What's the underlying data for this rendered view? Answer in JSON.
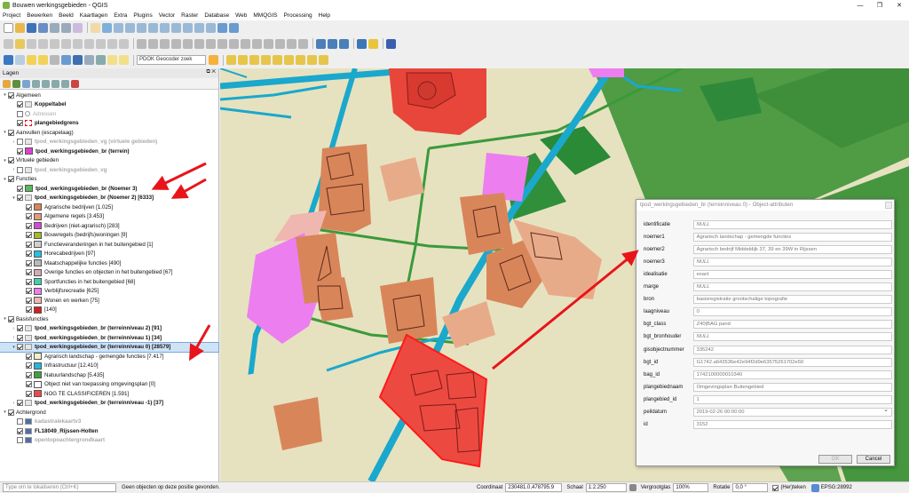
{
  "window": {
    "title": "Bouwen werkingsgebieden - QGIS",
    "controls": [
      "—",
      "❐",
      "✕"
    ]
  },
  "menu": [
    "Project",
    "Bewerken",
    "Beeld",
    "Kaartlagen",
    "Extra",
    "Plugins",
    "Vector",
    "Raster",
    "Database",
    "Web",
    "MMQGIS",
    "Processing",
    "Help"
  ],
  "toolbar": {
    "geocoder_placeholder": "PDOK Geocoder zoek"
  },
  "layers_panel": {
    "title": "Lagen",
    "controls": "⧉ ✕",
    "rows": [
      {
        "label": "Algemeen",
        "lvl": 0,
        "arrow": "▾",
        "cb": true
      },
      {
        "label": "Koppeltabel",
        "lvl": 1,
        "cb": true,
        "bold": true,
        "icon": "table"
      },
      {
        "label": "Adressen",
        "lvl": 1,
        "cb": false,
        "grey": true,
        "icon": "point"
      },
      {
        "label": "plangebiedgrens",
        "lvl": 1,
        "cb": true,
        "bold": true,
        "icon": "border"
      },
      {
        "label": "Aanvullen (escapelaag)",
        "lvl": 0,
        "arrow": "▾",
        "cb": true
      },
      {
        "label": "tpod_werkingsgebieden_vg (virtuele gebieden)",
        "lvl": 1,
        "arrow": "›",
        "cb": false,
        "grey": true,
        "bold": true,
        "icon": "group"
      },
      {
        "label": "tpod_werkingsgebieden_br (terrein)",
        "lvl": 1,
        "cb": true,
        "bold": true,
        "swatch": "#e040d0"
      },
      {
        "label": "Virtuele gebieden",
        "lvl": 0,
        "arrow": "▾",
        "cb": true
      },
      {
        "label": "tpod_werkingsgebieden_vg",
        "lvl": 1,
        "arrow": "›",
        "cb": false,
        "grey": true,
        "bold": true,
        "icon": "group"
      },
      {
        "label": "Functies",
        "lvl": 0,
        "arrow": "▾",
        "cb": true
      },
      {
        "label": "tpod_werkingsgebieden_br (Noemer 3)",
        "lvl": 1,
        "cb": true,
        "bold": true,
        "swatch": "#5cb85c"
      },
      {
        "label": "tpod_werkingsgebieden_br (Noemer 2) [6333]",
        "lvl": 1,
        "arrow": "▾",
        "cb": true,
        "bold": true,
        "icon": "group"
      },
      {
        "label": "Agrarische bedrijven [1.025]",
        "lvl": 2,
        "cb": true,
        "swatch": "#d9855a"
      },
      {
        "label": "Algemene regels [3.453]",
        "lvl": 2,
        "cb": true,
        "swatch": "#e89a76"
      },
      {
        "label": "Bedrijven (niet-agrarisch) [283]",
        "lvl": 2,
        "cb": true,
        "swatch": "#d24bd6"
      },
      {
        "label": "Bouwregels (bedrijfs)woningen [9]",
        "lvl": 2,
        "cb": true,
        "swatch": "#a7b82a"
      },
      {
        "label": "Functieveranderingen in het buitengebied [1]",
        "lvl": 2,
        "cb": true,
        "swatch": "#cfcfcf"
      },
      {
        "label": "Horecabedrijven [97]",
        "lvl": 2,
        "cb": true,
        "swatch": "#1fc2e8"
      },
      {
        "label": "Maatschappelijke functies [490]",
        "lvl": 2,
        "cb": true,
        "swatch": "#b9b9b9"
      },
      {
        "label": "Overige functies en objecten in het buitengebied [67]",
        "lvl": 2,
        "cb": true,
        "swatch": "#d6a9b0"
      },
      {
        "label": "Sportfuncties in het buitengebied [68]",
        "lvl": 2,
        "cb": true,
        "swatch": "#3fd0b0"
      },
      {
        "label": "Verblijfsrecreatie [625]",
        "lvl": 2,
        "cb": true,
        "swatch": "#ec7ef0"
      },
      {
        "label": "Wonen en werken [75]",
        "lvl": 2,
        "cb": true,
        "swatch": "#f0b7b0"
      },
      {
        "label": "[140]",
        "lvl": 2,
        "cb": true,
        "swatch": "#d71f1f"
      },
      {
        "label": "Basisfuncties",
        "lvl": 0,
        "arrow": "▾",
        "cb": true
      },
      {
        "label": "tpod_werkingsgebieden_br (terreinniveau 2) [91]",
        "lvl": 1,
        "arrow": "›",
        "cb": true,
        "bold": true,
        "icon": "group"
      },
      {
        "label": "tpod_werkingsgebieden_br (terreinniveau 1) [34]",
        "lvl": 1,
        "arrow": "›",
        "cb": true,
        "bold": true,
        "icon": "group"
      },
      {
        "label": "tpod_werkingsgebieden_br (terreinniveau 0) [28579]",
        "lvl": 1,
        "arrow": "▾",
        "cb": true,
        "bold": true,
        "icon": "group",
        "selected": true
      },
      {
        "label": "Agrarisch landschap - gemengde functies [7.417]",
        "lvl": 2,
        "cb": true,
        "swatch": "#f3efc2"
      },
      {
        "label": "Infrastructuur [12.410]",
        "lvl": 2,
        "cb": true,
        "swatch": "#22b8d8"
      },
      {
        "label": "Natuurlandschap [5.435]",
        "lvl": 2,
        "cb": true,
        "swatch": "#41a13b"
      },
      {
        "label": "Object niet van toepassing omgevingsplan [0]",
        "lvl": 2,
        "cb": true,
        "swatch": "#ffffff"
      },
      {
        "label": "NOG TE CLASSIFICEREN [1.591]",
        "lvl": 2,
        "cb": true,
        "swatch": "#ef4a4a"
      },
      {
        "label": "tpod_werkingsgebieden_br (terreinniveau -1) [37]",
        "lvl": 1,
        "arrow": "›",
        "cb": true,
        "bold": true,
        "icon": "group"
      },
      {
        "label": "Achtergrond",
        "lvl": 0,
        "arrow": "▾",
        "cb": true
      },
      {
        "label": "kadastralekaartv3",
        "lvl": 1,
        "cb": false,
        "grey": true,
        "bold": true,
        "icon": "raster"
      },
      {
        "label": "FL18049_Rijssen-Holten",
        "lvl": 1,
        "cb": true,
        "bold": true,
        "icon": "raster"
      },
      {
        "label": "opentopoachtergrondkaart",
        "lvl": 1,
        "cb": false,
        "grey": true,
        "bold": true,
        "icon": "raster"
      }
    ]
  },
  "dialog": {
    "title": "tpod_werkingsgebieden_br (terreinniveau 0) - Object-attributen",
    "fields": [
      {
        "label": "identificatie",
        "value": "NULL"
      },
      {
        "label": "noemer1",
        "value": "Agrarisch landschap - gemengde functies"
      },
      {
        "label": "noemer2",
        "value": "Agrarisch bedrijf Middeldijk 37, 39 en 39W in Rijssen"
      },
      {
        "label": "noemer3",
        "value": "NULL"
      },
      {
        "label": "idealisatie",
        "value": "exact"
      },
      {
        "label": "marge",
        "value": "NULL"
      },
      {
        "label": "bron",
        "value": "basisregistratie grootschalige topografie"
      },
      {
        "label": "laagniveau",
        "value": "0"
      },
      {
        "label": "bgt_class",
        "value": "Z40|BAG pand"
      },
      {
        "label": "bgt_bronhouder",
        "value": "NULL"
      },
      {
        "label": "gisobjectnummer",
        "value": "335242"
      },
      {
        "label": "bgt_id",
        "value": "G1742.a643536e42e94f2d9e63575261702e50"
      },
      {
        "label": "bag_id",
        "value": "1742100000010340"
      },
      {
        "label": "plangebiednaam",
        "value": "Omgevingsplan Buitengebied"
      },
      {
        "label": "plangebied_id",
        "value": "1"
      },
      {
        "label": "peildatum",
        "value": "2019-02-26 00:00:00",
        "combo": true
      },
      {
        "label": "id",
        "value": "3152"
      }
    ],
    "ok": "OK",
    "cancel": "Cancel"
  },
  "statusbar": {
    "locator_placeholder": "Type om te lokaliseren (Ctrl+K)",
    "message": "Geen objecten op deze positie gevonden.",
    "coord_label": "Coordinaat",
    "coord_value": "230481.0,478795.9",
    "scale_label": "Schaal",
    "scale_value": "1:2.250",
    "magnifier_label": "Vergrootglas",
    "magnifier_value": "100%",
    "rotation_label": "Rotatie",
    "rotation_value": "0,0 °",
    "render_label": "(Her)teken",
    "crs": "EPSG:28992"
  },
  "colors": {
    "annotation_arrow": "#e8141a",
    "road": "#1aa8cc",
    "nature": "#4a9a45",
    "agri": "#e6e2c0"
  }
}
